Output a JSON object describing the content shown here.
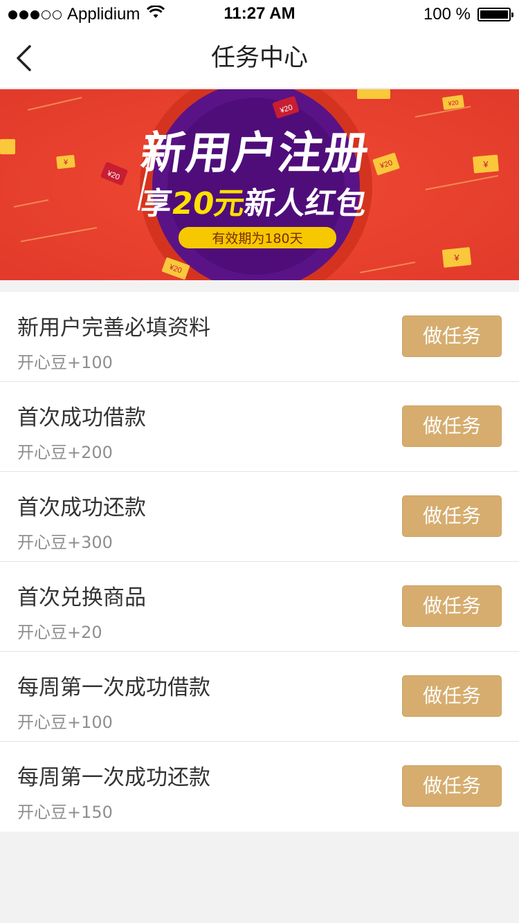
{
  "status_bar": {
    "carrier": "Applidium",
    "time": "11:27 AM",
    "battery": "100 %",
    "battery_level": 1.0,
    "icons": [
      "signal-dots-icon",
      "wifi-icon",
      "battery-icon"
    ]
  },
  "nav": {
    "title": "任务中心",
    "back_icon": "chevron-left-icon"
  },
  "banner": {
    "headline": "新用户注册",
    "subline_prefix": "享",
    "subline_amount": "20元",
    "subline_suffix": "新人红包",
    "validity": "有效期为180天",
    "envelope_label": "¥20",
    "coin_label": "¥",
    "colors": {
      "background": "#e8402e",
      "circle": "#5a1387",
      "highlight": "#ffe000",
      "pill": "#f5c800"
    }
  },
  "tasks": [
    {
      "name": "新用户完善必填资料",
      "reward": "开心豆+100",
      "button": "做任务"
    },
    {
      "name": "首次成功借款",
      "reward": "开心豆+200",
      "button": "做任务"
    },
    {
      "name": "首次成功还款",
      "reward": "开心豆+300",
      "button": "做任务"
    },
    {
      "name": "首次兑换商品",
      "reward": "开心豆+20",
      "button": "做任务"
    },
    {
      "name": "每周第一次成功借款",
      "reward": "开心豆+100",
      "button": "做任务"
    },
    {
      "name": "每周第一次成功还款",
      "reward": "开心豆+150",
      "button": "做任务"
    }
  ],
  "colors": {
    "button": "#d6ad6f",
    "page_bg": "#f2f2f2"
  }
}
